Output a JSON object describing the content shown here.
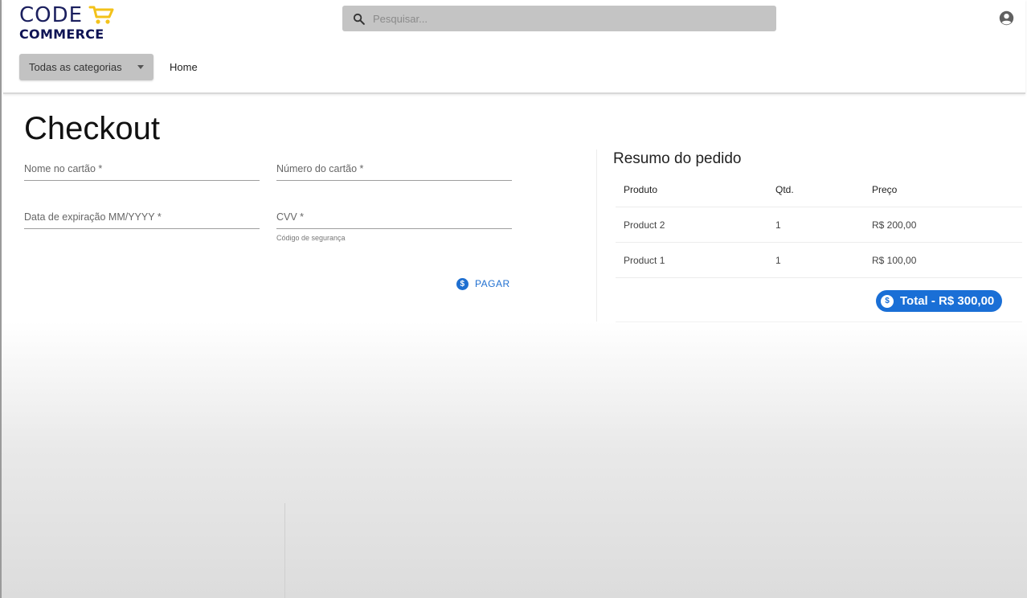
{
  "header": {
    "logo": {
      "line1": "CODE",
      "line2": "COMMERCE"
    },
    "search": {
      "placeholder": "Pesquisar..."
    },
    "categories_button": "Todas as categorias",
    "home_link": "Home"
  },
  "checkout": {
    "title": "Checkout",
    "fields": {
      "card_name": {
        "label": "Nome no cartão *",
        "value": ""
      },
      "card_number": {
        "label": "Número do cartão *",
        "value": ""
      },
      "expiration": {
        "label": "Data de expiração MM/YYYY *",
        "value": ""
      },
      "cvv": {
        "label": "CVV *",
        "value": "",
        "helper": "Código de segurança"
      }
    },
    "pay_button": {
      "label": "PAGAR",
      "icon": "dollar-coin-icon"
    }
  },
  "summary": {
    "title": "Resumo do pedido",
    "columns": [
      "Produto",
      "Qtd.",
      "Preço"
    ],
    "rows": [
      [
        "Product 2",
        "1",
        "R$ 200,00"
      ],
      [
        "Product 1",
        "1",
        "R$ 100,00"
      ]
    ],
    "total": "Total - R$ 300,00"
  },
  "colors": {
    "accent": "#1f6fd0",
    "brand_dark": "#0f1455",
    "brand_cart": "#f3c21a"
  }
}
